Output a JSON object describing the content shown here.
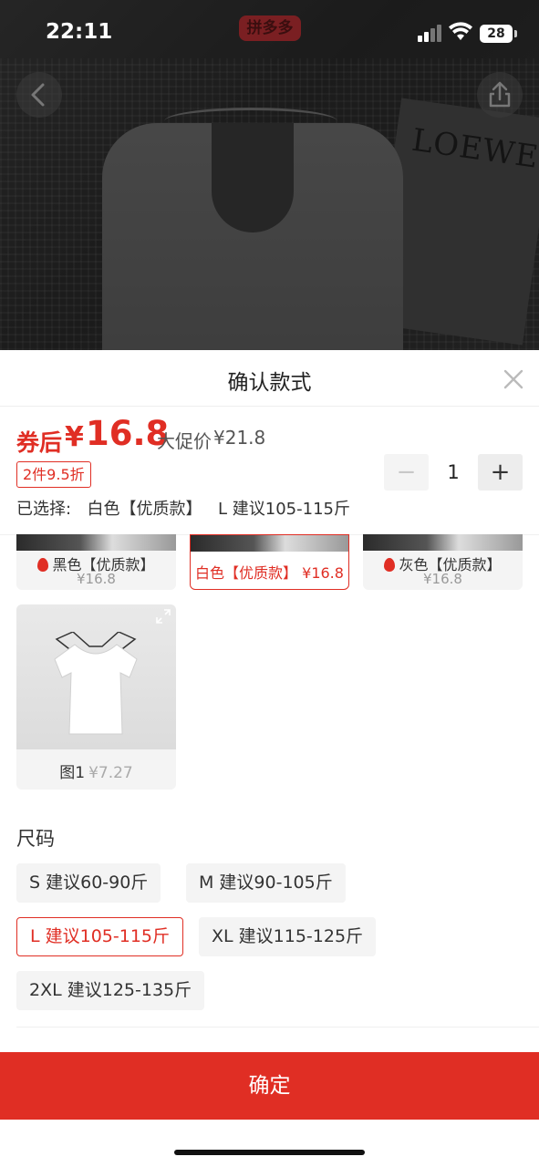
{
  "status_bar": {
    "time": "22:11",
    "app_badge": "拼多多",
    "battery": "28",
    "icons": [
      "signal-icon",
      "wifi-icon",
      "battery-icon"
    ]
  },
  "product_photo": {
    "magazine_text": "LOEWE",
    "nav": {
      "back_icon": "chevron-left-icon",
      "share_icon": "share-icon"
    }
  },
  "sheet": {
    "title": "确认款式",
    "close_icon": "close-icon",
    "price": {
      "coupon_label": "券后",
      "symbol": "¥",
      "value": "16.8",
      "promo_label": "大促价",
      "promo_price": "¥21.8"
    },
    "discount_tag": "2件9.5折",
    "quantity": {
      "minus": "−",
      "value": "1",
      "plus": "+"
    },
    "selected": {
      "prefix": "已选择:",
      "color": "白色【优质款】",
      "size": "L 建议105-115斤"
    },
    "colors": [
      {
        "label": "黑色【优质款】",
        "price": "¥16.8",
        "hot": true,
        "selected": false
      },
      {
        "label": "白色【优质款】",
        "price": "¥16.8",
        "hot": false,
        "selected": true
      },
      {
        "label": "灰色【优质款】",
        "price": "¥16.8",
        "hot": true,
        "selected": false
      }
    ],
    "image_option": {
      "name": "图1",
      "price": "¥7.27"
    },
    "size_title": "尺码",
    "sizes": [
      {
        "label": "S 建议60-90斤",
        "selected": false
      },
      {
        "label": "M 建议90-105斤",
        "selected": false
      },
      {
        "label": "L 建议105-115斤",
        "selected": true
      },
      {
        "label": "XL 建议115-125斤",
        "selected": false
      },
      {
        "label": "2XL 建议125-135斤",
        "selected": false
      }
    ],
    "confirm_label": "确定"
  },
  "colors": {
    "accent": "#e02e24",
    "chip_bg": "#f4f4f4"
  }
}
